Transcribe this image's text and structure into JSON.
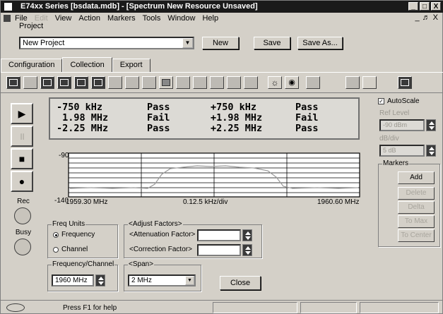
{
  "window": {
    "title": "E74xx Series [bsdata.mdb] - [Spectrum    New Resource      Unsaved]",
    "min": "_",
    "max": "□",
    "close": "X"
  },
  "menu": {
    "items": [
      "File",
      "Edit",
      "View",
      "Action",
      "Markers",
      "Tools",
      "Window",
      "Help"
    ],
    "mdi_min": "_",
    "mdi_restore": "♬",
    "mdi_close": "X"
  },
  "project": {
    "label": "Project",
    "value": "New Project",
    "new_label": "New",
    "save_label": "Save",
    "save_as_label": "Save As..."
  },
  "tabs": [
    "Configuration",
    "Collection",
    "Export"
  ],
  "results": {
    "rows": [
      [
        "-750 kHz",
        "Pass",
        "+750 kHz",
        "Pass"
      ],
      [
        " 1.98 MHz",
        "Fail",
        "+1.98 MHz",
        "Fail"
      ],
      [
        "-2.25 MHz",
        "Pass",
        "+2.25 MHz",
        "Pass"
      ]
    ]
  },
  "graph": {
    "y_top": "-90",
    "y_bottom": "-140",
    "x_left": "1959.30 MHz",
    "x_center": "0.12.5 kHz/div",
    "x_right": "1960.60 MHz"
  },
  "controls": {
    "rec_label": "Rec",
    "busy_label": "Busy",
    "play_icon": "▶",
    "pause_icon": "॥",
    "stop_icon": "■",
    "record_icon": "●"
  },
  "freq_units": {
    "title": "Freq Units",
    "frequency": "Frequency",
    "channel": "Channel"
  },
  "adjust": {
    "title": "<Adjust Factors>",
    "attenuation": "<Attenuation Factor>",
    "correction": "<Correction Factor>"
  },
  "freq_channel": {
    "title": "Frequency/Channel",
    "value": "1960 MHz"
  },
  "span": {
    "title": "<Span>",
    "value": "2 MHz"
  },
  "close_label": "Close",
  "right": {
    "autoscale": "AutoScale",
    "ref_level": "Ref Level",
    "ref_value": "-90 dBm",
    "db_div": "dB/div",
    "db_value": "5 dB",
    "markers": "Markers",
    "add": "Add",
    "delete": "Delete",
    "delta": "Delta",
    "to_max": "To Max",
    "to_center": "To Center"
  },
  "status": {
    "text": "Press F1 for help"
  }
}
